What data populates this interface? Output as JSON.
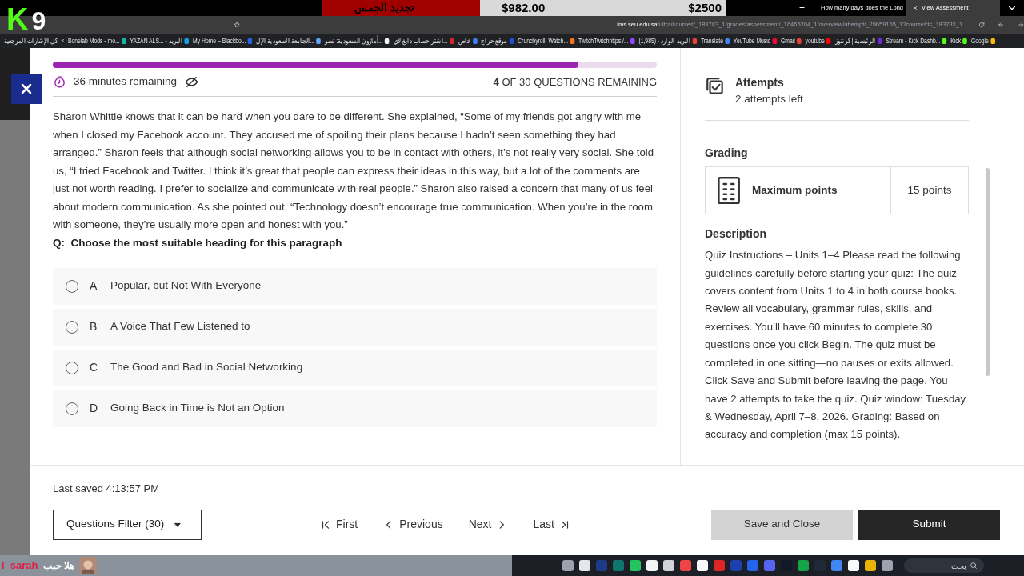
{
  "stream_overlay": {
    "logo": {
      "letter": "K",
      "digit": "9"
    },
    "goal": {
      "label": "تجديد الجمس",
      "current": "$982.00",
      "target": "$2500",
      "level": 0.39
    },
    "chat": {
      "user": "l_sarah",
      "message": "هلا حبب"
    }
  },
  "browser": {
    "tabs": [
      {
        "title": "How many days does the Lond",
        "selected": false
      },
      {
        "title": "View Assessment",
        "selected": true
      }
    ],
    "new_tab": "+",
    "url_host": "lms.seu.edu.sa",
    "url_path": "/ultra/courses/_183783_1/grades/assessment/_16465204_1/overview/attempt/_29659165_1?courseId=_183783_1",
    "bookmarks_all": "كل الإشارات المرجعية",
    "bookmarks_more": "«",
    "bookmarks": [
      {
        "title": "Bonelab Mods - mo...",
        "color": "#14b8a6"
      },
      {
        "title": "YAZAN ALS... - البريد",
        "color": "#0ea5e9"
      },
      {
        "title": "My Home – Blackbo...",
        "color": "#2563eb"
      },
      {
        "title": "الجامعة السعودية الإل...",
        "color": "#60a5fa"
      },
      {
        "title": "أمازون السعودية: تسو...",
        "color": "#f5f5f5"
      },
      {
        "title": "اشتر حساب دايغ لاي...",
        "color": "#dc2626"
      },
      {
        "title": "خاص",
        "color": "#3b82f6"
      },
      {
        "title": "موقع حراج",
        "color": "#1d4ed8"
      },
      {
        "title": "Crunchyroll: Watch...",
        "color": "#f97316"
      },
      {
        "title": "TwitchTwitchhttps:/...",
        "color": "#9146ff"
      },
      {
        "title": "(1,985) - البريد الوارد",
        "color": "#ea4335"
      },
      {
        "title": "Translate",
        "color": "#4285f4"
      },
      {
        "title": "YouTube Music",
        "color": "#ff0033"
      },
      {
        "title": "Gmail",
        "color": "#ea4335"
      },
      {
        "title": "youtube",
        "color": "#ff0000"
      },
      {
        "title": "الرئيسية | كرنتوز",
        "color": "#6d28d9"
      },
      {
        "title": "Stream - Kick Dashb...",
        "color": "#53fc18"
      },
      {
        "title": "Kick",
        "color": "#53fc18"
      },
      {
        "title": "Google",
        "color": "#fbbc05"
      }
    ]
  },
  "quiz": {
    "progress": {
      "level": 0.87
    },
    "timer": "36 minutes remaining",
    "timer_hidden": true,
    "remaining_count": "4",
    "remaining_text": "OF 30 QUESTIONS REMAINING",
    "passage": "Sharon Whittle knows that it can be hard when you dare to be different. She explained, “Some of my friends got angry with me when I closed my Facebook account. They accused me of spoiling their plans because I hadn’t seen something they had arranged.” Sharon feels that although social networking allows you to be in contact with others, it’s not really very social. She told us, “I tried Facebook and Twitter. I think it’s great that people can express their ideas in this way, but a lot of the comments are just not worth reading. I prefer to socialize and communicate with real people.” Sharon also raised a concern that many of us feel about modern communication. As she pointed out, “Technology doesn’t encourage true communication. When you’re in the room with someone, they’re usually more open and honest with you.”",
    "question": "Q:  Choose the most suitable heading for this paragraph",
    "options": [
      {
        "letter": "A",
        "text": "Popular, but Not With Everyone",
        "selected": false
      },
      {
        "letter": "B",
        "text": "A Voice That Few Listened to",
        "selected": false
      },
      {
        "letter": "C",
        "text": "The Good and Bad in Social Networking",
        "selected": false
      },
      {
        "letter": "D",
        "text": "Going Back in Time is Not an Option",
        "selected": false
      }
    ],
    "last_saved": "Last saved 4:13:57 PM",
    "filter": "Questions Filter (30)",
    "nav": [
      "First",
      "Previous",
      "Next",
      "Last"
    ],
    "save_close": "Save and Close",
    "submit": "Submit"
  },
  "details": {
    "attempts_title": "Attempts",
    "attempts_value": "2 attempts left",
    "grading_title": "Grading",
    "max_label": "Maximum points",
    "max_value": "15 points",
    "description_title": "Description",
    "description": "Quiz Instructions – Units 1–4 Please read the following guidelines carefully before starting your quiz: The quiz covers content from Units 1 to 4 in both course books. Review all vocabulary, grammar rules, skills, and exercises. You’ll have 60 minutes to complete 30 questions once you click Begin. The quiz must be completed in one sitting—no pauses or exits allowed. Click Save and Submit before leaving the page. You have 2 attempts to take the quiz. Quiz window: Tuesday & Wednesday, April 7–8, 2026. Grading: Based on accuracy and completion (max 15 points)."
  },
  "taskbar": {
    "search_placeholder": "بحث",
    "apps": [
      {
        "color": "#9ca3af"
      },
      {
        "color": "#e5e7eb"
      },
      {
        "color": "#1e3a8a"
      },
      {
        "color": "#0f766e"
      },
      {
        "color": "#22c55e"
      },
      {
        "color": "#f3f4f6"
      },
      {
        "color": "#d1d5db"
      },
      {
        "color": "#ef4444"
      },
      {
        "color": "#f9fafb"
      },
      {
        "color": "#dc2626"
      },
      {
        "color": "#1e40af"
      },
      {
        "color": "#2563eb"
      },
      {
        "color": "#5865f2"
      },
      {
        "color": "#111827"
      },
      {
        "color": "#16a34a"
      },
      {
        "color": "#1f2937"
      },
      {
        "color": "#4285f4"
      },
      {
        "color": "#f8fafc"
      },
      {
        "color": "#eab308"
      },
      {
        "color": "#9ca3af"
      }
    ]
  }
}
